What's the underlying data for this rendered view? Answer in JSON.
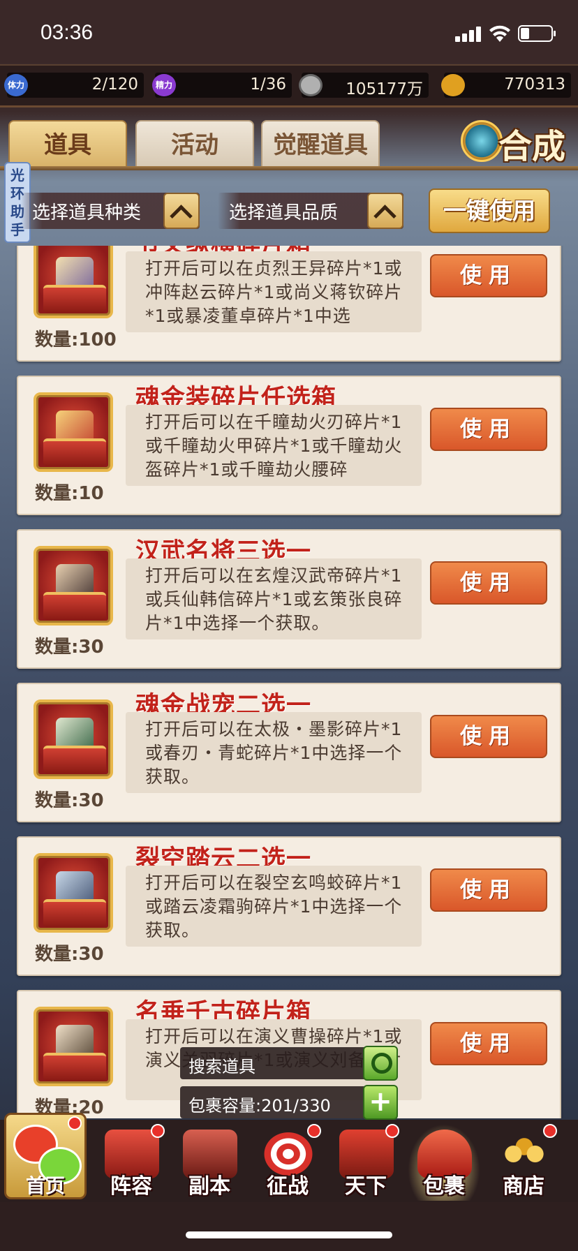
{
  "status": {
    "time": "03:36"
  },
  "resources": [
    {
      "icon": "stamina-icon",
      "icon_text": "体力",
      "value": "2/120",
      "color": "#3a6ad0"
    },
    {
      "icon": "energy-icon",
      "icon_text": "精力",
      "value": "1/36",
      "color": "#8a3ad0"
    },
    {
      "icon": "coin-icon",
      "icon_text": "",
      "value": "105177万",
      "color": "#b0b0b0"
    },
    {
      "icon": "gold-ingot-icon",
      "icon_text": "",
      "value": "770313",
      "color": "#e0a020"
    }
  ],
  "tabs": [
    {
      "label": "道具",
      "active": true
    },
    {
      "label": "活动",
      "active": false
    },
    {
      "label": "觉醒道具",
      "active": false
    }
  ],
  "synth_label": "合成",
  "helper_label": "光环助手",
  "filters": {
    "type_label": "选择道具种类",
    "quality_label": "选择道具品质",
    "one_use_label": "一键使用"
  },
  "items": [
    {
      "title": "节义纵横碎片箱",
      "desc": "打开后可以在贞烈王异碎片*1或冲阵赵云碎片*1或尚义蒋钦碎片*1或暴凌董卓碎片*1中选",
      "qty": "数量:100",
      "use": "使用"
    },
    {
      "title": "魂金装碎片任选箱",
      "desc": "打开后可以在千瞳劫火刃碎片*1或千瞳劫火甲碎片*1或千瞳劫火盔碎片*1或千瞳劫火腰碎",
      "qty": "数量:10",
      "use": "使用"
    },
    {
      "title": "汉武名将三选一",
      "desc": "打开后可以在玄煌汉武帝碎片*1或兵仙韩信碎片*1或玄策张良碎片*1中选择一个获取。",
      "qty": "数量:30",
      "use": "使用"
    },
    {
      "title": "魂金战宠二选一",
      "desc": "打开后可以在太极・墨影碎片*1或春刃・青蛇碎片*1中选择一个获取。",
      "qty": "数量:30",
      "use": "使用"
    },
    {
      "title": "裂空踏云二选一",
      "desc": "打开后可以在裂空玄鸣蛟碎片*1或踏云凌霜驹碎片*1中选择一个获取。",
      "qty": "数量:30",
      "use": "使用"
    },
    {
      "title": "名垂千古碎片箱",
      "desc": "打开后可以在演义曹操碎片*1或演义关羽碎片*1或演义刘备碎片",
      "qty": "数量:20",
      "use": "使用"
    }
  ],
  "search": {
    "label": "搜索道具",
    "capacity_label": "包裹容量:201/330"
  },
  "nav": [
    {
      "label": "首页",
      "dot": true,
      "art": "#e8402a"
    },
    {
      "label": "阵容",
      "dot": true,
      "art": "#c83a2a"
    },
    {
      "label": "副本",
      "dot": false,
      "art": "#b84a3a"
    },
    {
      "label": "征战",
      "dot": true,
      "art": "#d0502a"
    },
    {
      "label": "天下",
      "dot": true,
      "art": "#c8302a"
    },
    {
      "label": "包裹",
      "dot": false,
      "art": "#d84a3a"
    },
    {
      "label": "商店",
      "dot": true,
      "art": "#e0b040"
    }
  ]
}
